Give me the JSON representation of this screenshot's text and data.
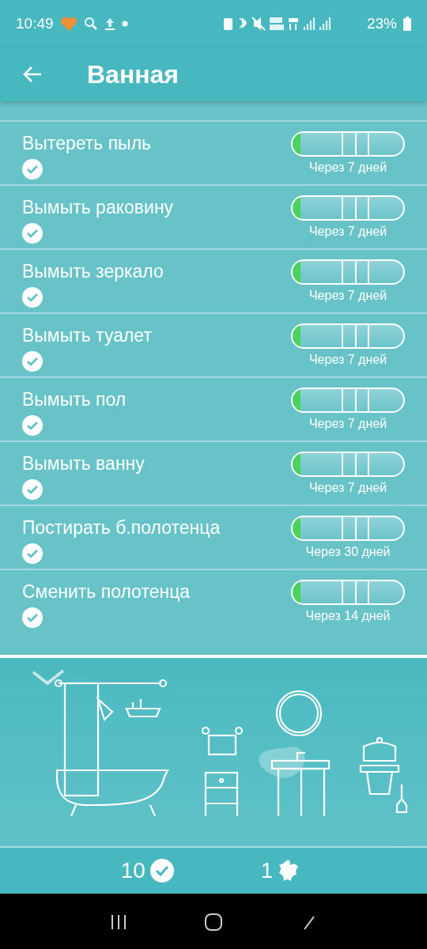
{
  "status_bar": {
    "time": "10:49",
    "battery": "23%"
  },
  "app_bar": {
    "title": "Ванная"
  },
  "tasks": [
    {
      "name": "Вытереть пыль",
      "checked": true,
      "level": 0.07,
      "due": "Через 7 дней"
    },
    {
      "name": "Вымыть раковину",
      "checked": true,
      "level": 0.07,
      "due": "Через 7 дней"
    },
    {
      "name": "Вымыть зеркало",
      "checked": true,
      "level": 0.07,
      "due": "Через 7 дней"
    },
    {
      "name": "Вымыть туалет",
      "checked": true,
      "level": 0.07,
      "due": "Через 7 дней"
    },
    {
      "name": "Вымыть пол",
      "checked": true,
      "level": 0.07,
      "due": "Через 7 дней"
    },
    {
      "name": "Вымыть ванну",
      "checked": true,
      "level": 0.07,
      "due": "Через 7 дней"
    },
    {
      "name": "Постирать б.полотенца",
      "checked": true,
      "level": 0.07,
      "due": "Через 30 дней"
    },
    {
      "name": "Сменить полотенца",
      "checked": true,
      "level": 0.07,
      "due": "Через 14 дней"
    }
  ],
  "summary": {
    "done_count": "10",
    "dirty_count": "1"
  }
}
